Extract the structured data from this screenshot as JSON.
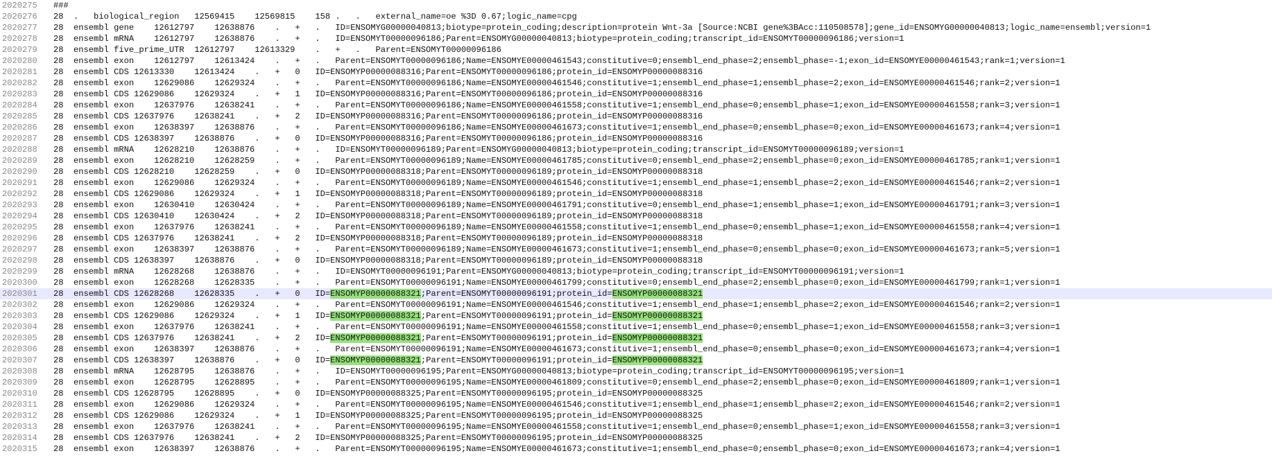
{
  "colors": {
    "current_line": "#e8e8ff",
    "match_highlight": "#95e27a",
    "line_number": "#8a8a8a",
    "text": "#111111"
  },
  "highlight_term": "ENSOMYP00000088321",
  "current_line_index": 26,
  "lines": [
    {
      "num": "2020275",
      "text": "###"
    },
    {
      "num": "2020276",
      "text": "28  .   biological_region   12569415    12569815    158 .   .   external_name=oe %3D 0.67;logic_name=cpg"
    },
    {
      "num": "2020277",
      "text": "28  ensembl gene    12612797    12638876    .   +   .   ID=ENSOMYG00000040813;biotype=protein_coding;description=protein Wnt-3a [Source:NCBI gene%3BAcc:110508578];gene_id=ENSOMYG00000040813;logic_name=ensembl;version=1"
    },
    {
      "num": "2020278",
      "text": "28  ensembl mRNA    12612797    12638876    .   +   .   ID=ENSOMYT00000096186;Parent=ENSOMYG00000040813;biotype=protein_coding;transcript_id=ENSOMYT00000096186;version=1"
    },
    {
      "num": "2020279",
      "text": "28  ensembl five_prime_UTR  12612797    12613329    .   +   .   Parent=ENSOMYT00000096186"
    },
    {
      "num": "2020280",
      "text": "28  ensembl exon    12612797    12613424    .   +   .   Parent=ENSOMYT00000096186;Name=ENSOMYE00000461543;constitutive=0;ensembl_end_phase=2;ensembl_phase=-1;exon_id=ENSOMYE00000461543;rank=1;version=1"
    },
    {
      "num": "2020281",
      "text": "28  ensembl CDS 12613330    12613424    .   +   0   ID=ENSOMYP00000088316;Parent=ENSOMYT00000096186;protein_id=ENSOMYP00000088316"
    },
    {
      "num": "2020282",
      "text": "28  ensembl exon    12629086    12629324    .   +   .   Parent=ENSOMYT00000096186;Name=ENSOMYE00000461546;constitutive=1;ensembl_end_phase=1;ensembl_phase=2;exon_id=ENSOMYE00000461546;rank=2;version=1"
    },
    {
      "num": "2020283",
      "text": "28  ensembl CDS 12629086    12629324    .   +   1   ID=ENSOMYP00000088316;Parent=ENSOMYT00000096186;protein_id=ENSOMYP00000088316"
    },
    {
      "num": "2020284",
      "text": "28  ensembl exon    12637976    12638241    .   +   .   Parent=ENSOMYT00000096186;Name=ENSOMYE00000461558;constitutive=1;ensembl_end_phase=0;ensembl_phase=1;exon_id=ENSOMYE00000461558;rank=3;version=1"
    },
    {
      "num": "2020285",
      "text": "28  ensembl CDS 12637976    12638241    .   +   2   ID=ENSOMYP00000088316;Parent=ENSOMYT00000096186;protein_id=ENSOMYP00000088316"
    },
    {
      "num": "2020286",
      "text": "28  ensembl exon    12638397    12638876    .   +   .   Parent=ENSOMYT00000096186;Name=ENSOMYE00000461673;constitutive=1;ensembl_end_phase=0;ensembl_phase=0;exon_id=ENSOMYE00000461673;rank=4;version=1"
    },
    {
      "num": "2020287",
      "text": "28  ensembl CDS 12638397    12638876    .   +   0   ID=ENSOMYP00000088316;Parent=ENSOMYT00000096186;protein_id=ENSOMYP00000088316"
    },
    {
      "num": "2020288",
      "text": "28  ensembl mRNA    12628210    12638876    .   +   .   ID=ENSOMYT00000096189;Parent=ENSOMYG00000040813;biotype=protein_coding;transcript_id=ENSOMYT00000096189;version=1"
    },
    {
      "num": "2020289",
      "text": "28  ensembl exon    12628210    12628259    .   +   .   Parent=ENSOMYT00000096189;Name=ENSOMYE00000461785;constitutive=0;ensembl_end_phase=2;ensembl_phase=0;exon_id=ENSOMYE00000461785;rank=1;version=1"
    },
    {
      "num": "2020290",
      "text": "28  ensembl CDS 12628210    12628259    .   +   0   ID=ENSOMYP00000088318;Parent=ENSOMYT00000096189;protein_id=ENSOMYP00000088318"
    },
    {
      "num": "2020291",
      "text": "28  ensembl exon    12629086    12629324    .   +   .   Parent=ENSOMYT00000096189;Name=ENSOMYE00000461546;constitutive=1;ensembl_end_phase=1;ensembl_phase=2;exon_id=ENSOMYE00000461546;rank=2;version=1"
    },
    {
      "num": "2020292",
      "text": "28  ensembl CDS 12629086    12629324    .   +   1   ID=ENSOMYP00000088318;Parent=ENSOMYT00000096189;protein_id=ENSOMYP00000088318"
    },
    {
      "num": "2020293",
      "text": "28  ensembl exon    12630410    12630424    .   +   .   Parent=ENSOMYT00000096189;Name=ENSOMYE00000461791;constitutive=0;ensembl_end_phase=1;ensembl_phase=1;exon_id=ENSOMYE00000461791;rank=3;version=1"
    },
    {
      "num": "2020294",
      "text": "28  ensembl CDS 12630410    12630424    .   +   2   ID=ENSOMYP00000088318;Parent=ENSOMYT00000096189;protein_id=ENSOMYP00000088318"
    },
    {
      "num": "2020295",
      "text": "28  ensembl exon    12637976    12638241    .   +   .   Parent=ENSOMYT00000096189;Name=ENSOMYE00000461558;constitutive=1;ensembl_end_phase=0;ensembl_phase=1;exon_id=ENSOMYE00000461558;rank=4;version=1"
    },
    {
      "num": "2020296",
      "text": "28  ensembl CDS 12637976    12638241    .   +   2   ID=ENSOMYP00000088318;Parent=ENSOMYT00000096189;protein_id=ENSOMYP00000088318"
    },
    {
      "num": "2020297",
      "text": "28  ensembl exon    12638397    12638876    .   +   .   Parent=ENSOMYT00000096189;Name=ENSOMYE00000461673;constitutive=1;ensembl_end_phase=0;ensembl_phase=0;exon_id=ENSOMYE00000461673;rank=5;version=1"
    },
    {
      "num": "2020298",
      "text": "28  ensembl CDS 12638397    12638876    .   +   0   ID=ENSOMYP00000088318;Parent=ENSOMYT00000096189;protein_id=ENSOMYP00000088318"
    },
    {
      "num": "2020299",
      "text": "28  ensembl mRNA    12628268    12638876    .   +   .   ID=ENSOMYT00000096191;Parent=ENSOMYG00000040813;biotype=protein_coding;transcript_id=ENSOMYT00000096191;version=1"
    },
    {
      "num": "2020300",
      "text": "28  ensembl exon    12628268    12628335    .   +   .   Parent=ENSOMYT00000096191;Name=ENSOMYE00000461799;constitutive=0;ensembl_end_phase=2;ensembl_phase=0;exon_id=ENSOMYE00000461799;rank=1;version=1"
    },
    {
      "num": "2020301",
      "text": "28  ensembl CDS 12628268    12628335    .   +   0   ID=ENSOMYP00000088321;Parent=ENSOMYT00000096191;protein_id=ENSOMYP00000088321"
    },
    {
      "num": "2020302",
      "text": "28  ensembl exon    12629086    12629324    .   +   .   Parent=ENSOMYT00000096191;Name=ENSOMYE00000461546;constitutive=1;ensembl_end_phase=1;ensembl_phase=2;exon_id=ENSOMYE00000461546;rank=2;version=1"
    },
    {
      "num": "2020303",
      "text": "28  ensembl CDS 12629086    12629324    .   +   1   ID=ENSOMYP00000088321;Parent=ENSOMYT00000096191;protein_id=ENSOMYP00000088321"
    },
    {
      "num": "2020304",
      "text": "28  ensembl exon    12637976    12638241    .   +   .   Parent=ENSOMYT00000096191;Name=ENSOMYE00000461558;constitutive=1;ensembl_end_phase=0;ensembl_phase=1;exon_id=ENSOMYE00000461558;rank=3;version=1"
    },
    {
      "num": "2020305",
      "text": "28  ensembl CDS 12637976    12638241    .   +   2   ID=ENSOMYP00000088321;Parent=ENSOMYT00000096191;protein_id=ENSOMYP00000088321"
    },
    {
      "num": "2020306",
      "text": "28  ensembl exon    12638397    12638876    .   +   .   Parent=ENSOMYT00000096191;Name=ENSOMYE00000461673;constitutive=1;ensembl_end_phase=0;ensembl_phase=0;exon_id=ENSOMYE00000461673;rank=4;version=1"
    },
    {
      "num": "2020307",
      "text": "28  ensembl CDS 12638397    12638876    .   +   0   ID=ENSOMYP00000088321;Parent=ENSOMYT00000096191;protein_id=ENSOMYP00000088321"
    },
    {
      "num": "2020308",
      "text": "28  ensembl mRNA    12628795    12638876    .   +   .   ID=ENSOMYT00000096195;Parent=ENSOMYG00000040813;biotype=protein_coding;transcript_id=ENSOMYT00000096195;version=1"
    },
    {
      "num": "2020309",
      "text": "28  ensembl exon    12628795    12628895    .   +   .   Parent=ENSOMYT00000096195;Name=ENSOMYE00000461809;constitutive=0;ensembl_end_phase=2;ensembl_phase=0;exon_id=ENSOMYE00000461809;rank=1;version=1"
    },
    {
      "num": "2020310",
      "text": "28  ensembl CDS 12628795    12628895    .   +   0   ID=ENSOMYP00000088325;Parent=ENSOMYT00000096195;protein_id=ENSOMYP00000088325"
    },
    {
      "num": "2020311",
      "text": "28  ensembl exon    12629086    12629324    .   +   .   Parent=ENSOMYT00000096195;Name=ENSOMYE00000461546;constitutive=1;ensembl_end_phase=1;ensembl_phase=2;exon_id=ENSOMYE00000461546;rank=2;version=1"
    },
    {
      "num": "2020312",
      "text": "28  ensembl CDS 12629086    12629324    .   +   1   ID=ENSOMYP00000088325;Parent=ENSOMYT00000096195;protein_id=ENSOMYP00000088325"
    },
    {
      "num": "2020313",
      "text": "28  ensembl exon    12637976    12638241    .   +   .   Parent=ENSOMYT00000096195;Name=ENSOMYE00000461558;constitutive=1;ensembl_end_phase=0;ensembl_phase=1;exon_id=ENSOMYE00000461558;rank=3;version=1"
    },
    {
      "num": "2020314",
      "text": "28  ensembl CDS 12637976    12638241    .   +   2   ID=ENSOMYP00000088325;Parent=ENSOMYT00000096195;protein_id=ENSOMYP00000088325"
    },
    {
      "num": "2020315",
      "text": "28  ensembl exon    12638397    12638876    .   +   .   Parent=ENSOMYT00000096195;Name=ENSOMYE00000461673;constitutive=1;ensembl_end_phase=0;ensembl_phase=0;exon_id=ENSOMYE00000461673;rank=4;version=1"
    }
  ]
}
